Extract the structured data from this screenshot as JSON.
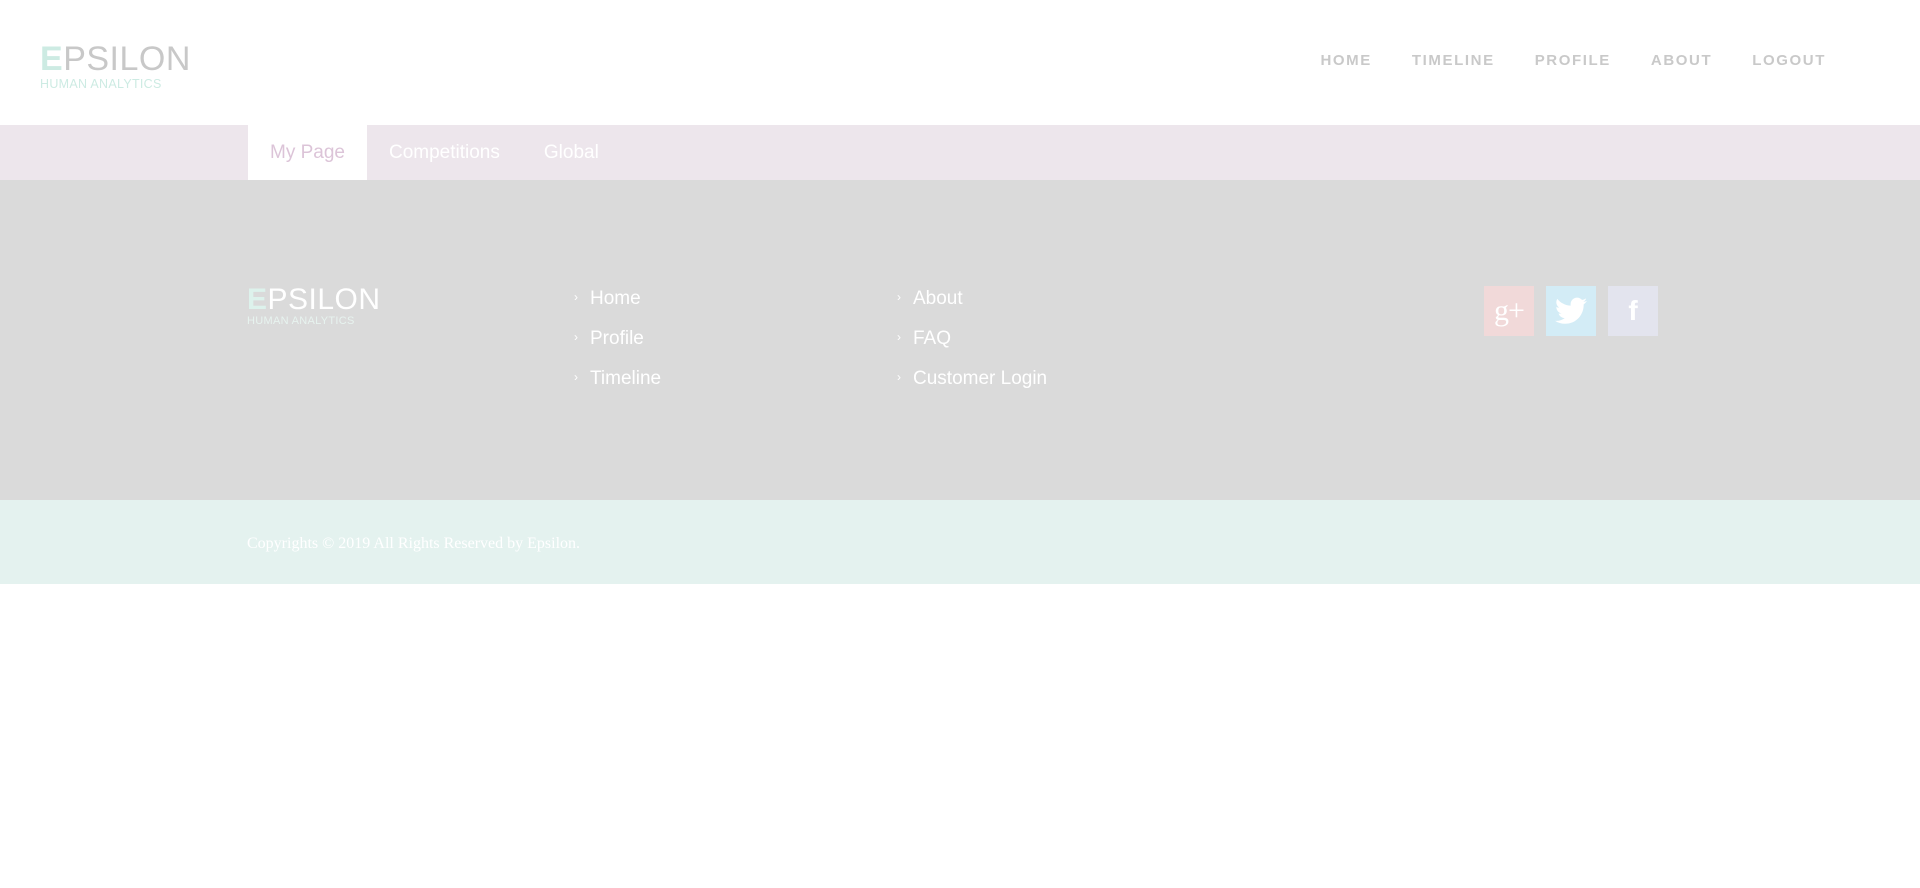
{
  "header": {
    "logo": {
      "word": "EPSILON",
      "subtitle": "HUMAN ANALYTICS"
    },
    "nav": [
      "HOME",
      "TIMELINE",
      "PROFILE",
      "ABOUT",
      "LOGOUT"
    ]
  },
  "tabs": [
    "My Page",
    "Competitions",
    "Global"
  ],
  "footer": {
    "logo": {
      "word": "EPSILON",
      "subtitle": "HUMAN ANALYTICS"
    },
    "column1": [
      "Home",
      "Profile",
      "Timeline"
    ],
    "column2": [
      "About",
      "FAQ",
      "Customer Login"
    ],
    "social": [
      {
        "name": "google-plus",
        "icon": "google-plus-icon",
        "glyph": "g+"
      },
      {
        "name": "twitter",
        "icon": "twitter-icon"
      },
      {
        "name": "facebook",
        "icon": "facebook-icon",
        "glyph": "f"
      }
    ],
    "copyright": "Copyrights © 2019 All Rights Reserved by Epsilon."
  },
  "colors": {
    "tabbar": "#ede6ec",
    "footer": "#dadada",
    "copybar": "#e4f2ef",
    "active_tab_text": "#dcc4d8",
    "accent_logo": "#cdebe3"
  }
}
